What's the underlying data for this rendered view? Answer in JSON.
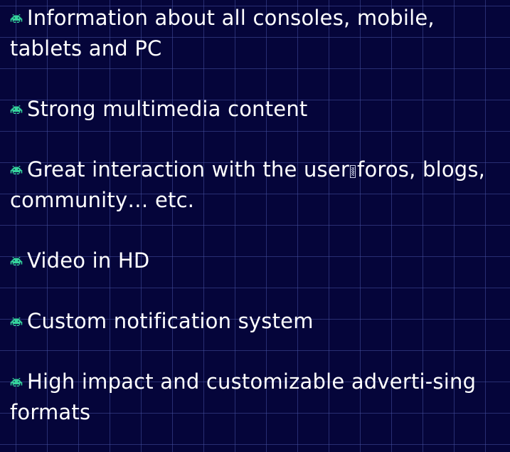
{
  "bullet_icon": "space-invader-icon",
  "bullet_color": "#35d39c",
  "features": [
    {
      "text": "Information about all consoles, mobile, tablets and PC"
    },
    {
      "text": "Strong multimedia content"
    },
    {
      "text_before": "Great interaction with the user",
      "text_after": "foros, blogs, community… etc."
    },
    {
      "text": "Video in HD"
    },
    {
      "text": "Custom notification system"
    },
    {
      "text": "High impact and customizable adverti-sing formats"
    }
  ]
}
